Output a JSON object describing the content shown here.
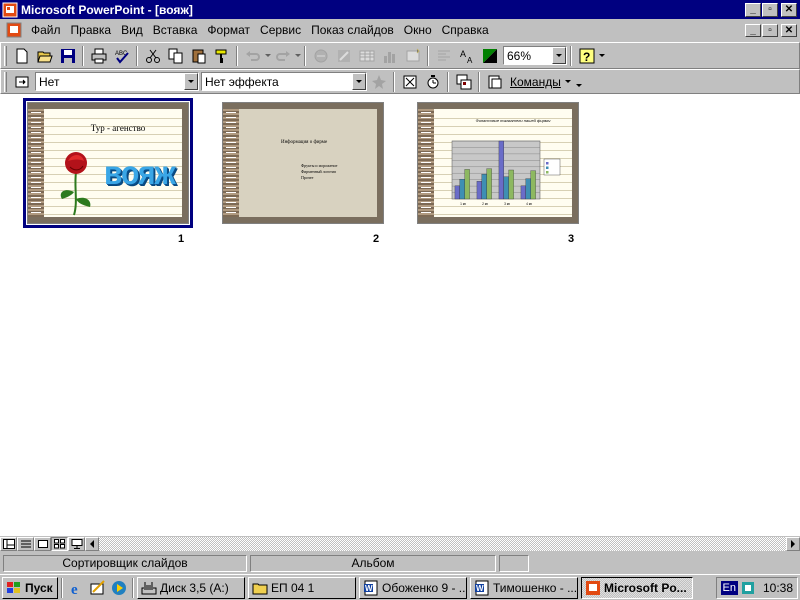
{
  "window": {
    "title": "Microsoft PowerPoint - [вояж]",
    "caption_buttons": [
      "minimize-icon",
      "restore-icon",
      "close-icon"
    ]
  },
  "menu": {
    "items": [
      "Файл",
      "Правка",
      "Вид",
      "Вставка",
      "Формат",
      "Сервис",
      "Показ слайдов",
      "Окно",
      "Справка"
    ]
  },
  "standard_toolbar": {
    "buttons": [
      "new-icon",
      "open-icon",
      "save-icon",
      "print-icon",
      "spelling-icon",
      "cut-icon",
      "copy-icon",
      "paste-icon",
      "format-painter-icon",
      "undo-icon",
      "redo-icon",
      "hyperlink-icon",
      "web-toolbar-icon",
      "insert-table-icon",
      "insert-chart-icon",
      "new-slide-icon",
      "expand-icon",
      "text-style-icon",
      "grayscale-icon",
      "help-icon"
    ],
    "zoom": "66%"
  },
  "slide_sorter_toolbar": {
    "transition_value": "Нет",
    "animation_value": "Нет эффекта",
    "commands_label": "Команды"
  },
  "slides": [
    {
      "number": "1",
      "title": "Тур - агенство",
      "wordart": "вояж",
      "selected": true
    },
    {
      "number": "2",
      "title": "Информация о фирме",
      "bullets": [
        "Фрукты и мороженое",
        "Фирменный логотип",
        "Прочее"
      ]
    },
    {
      "number": "3",
      "title": "Финансовые показатели нашей фирмы"
    }
  ],
  "chart_data": {
    "type": "bar",
    "categories": [
      "1 кв",
      "2 кв",
      "3 кв",
      "4 кв"
    ],
    "series": [
      {
        "color": "#6a6cc8",
        "values": [
          20.4,
          27.4,
          90,
          20.4
        ]
      },
      {
        "color": "#3e8fb3",
        "values": [
          30.6,
          38.6,
          34.6,
          31.6
        ]
      },
      {
        "color": "#8db860",
        "values": [
          45.9,
          46.9,
          45,
          43.9
        ]
      }
    ],
    "ylim": [
      0,
      90
    ],
    "legend": "right",
    "grid": true
  },
  "statusbar": {
    "view_name": "Сортировщик слайдов",
    "template": "Альбом"
  },
  "taskbar": {
    "start_label": "Пуск",
    "tasks": [
      {
        "label": "Диск 3,5 (A:)",
        "icon": "floppy-drive-icon",
        "active": false
      },
      {
        "label": "ЕП 04 1",
        "icon": "folder-icon",
        "active": false
      },
      {
        "label": "Обоженко 9 - ...",
        "icon": "word-doc-icon",
        "active": false
      },
      {
        "label": "Тимошенко - ...",
        "icon": "word-doc-icon",
        "active": false
      },
      {
        "label": "Microsoft Po...",
        "icon": "powerpoint-icon",
        "active": true
      }
    ],
    "language": "En",
    "time": "10:38"
  },
  "colors": {
    "titlebar": "#000080",
    "face": "#c0c0c0",
    "selection": "#000080"
  }
}
